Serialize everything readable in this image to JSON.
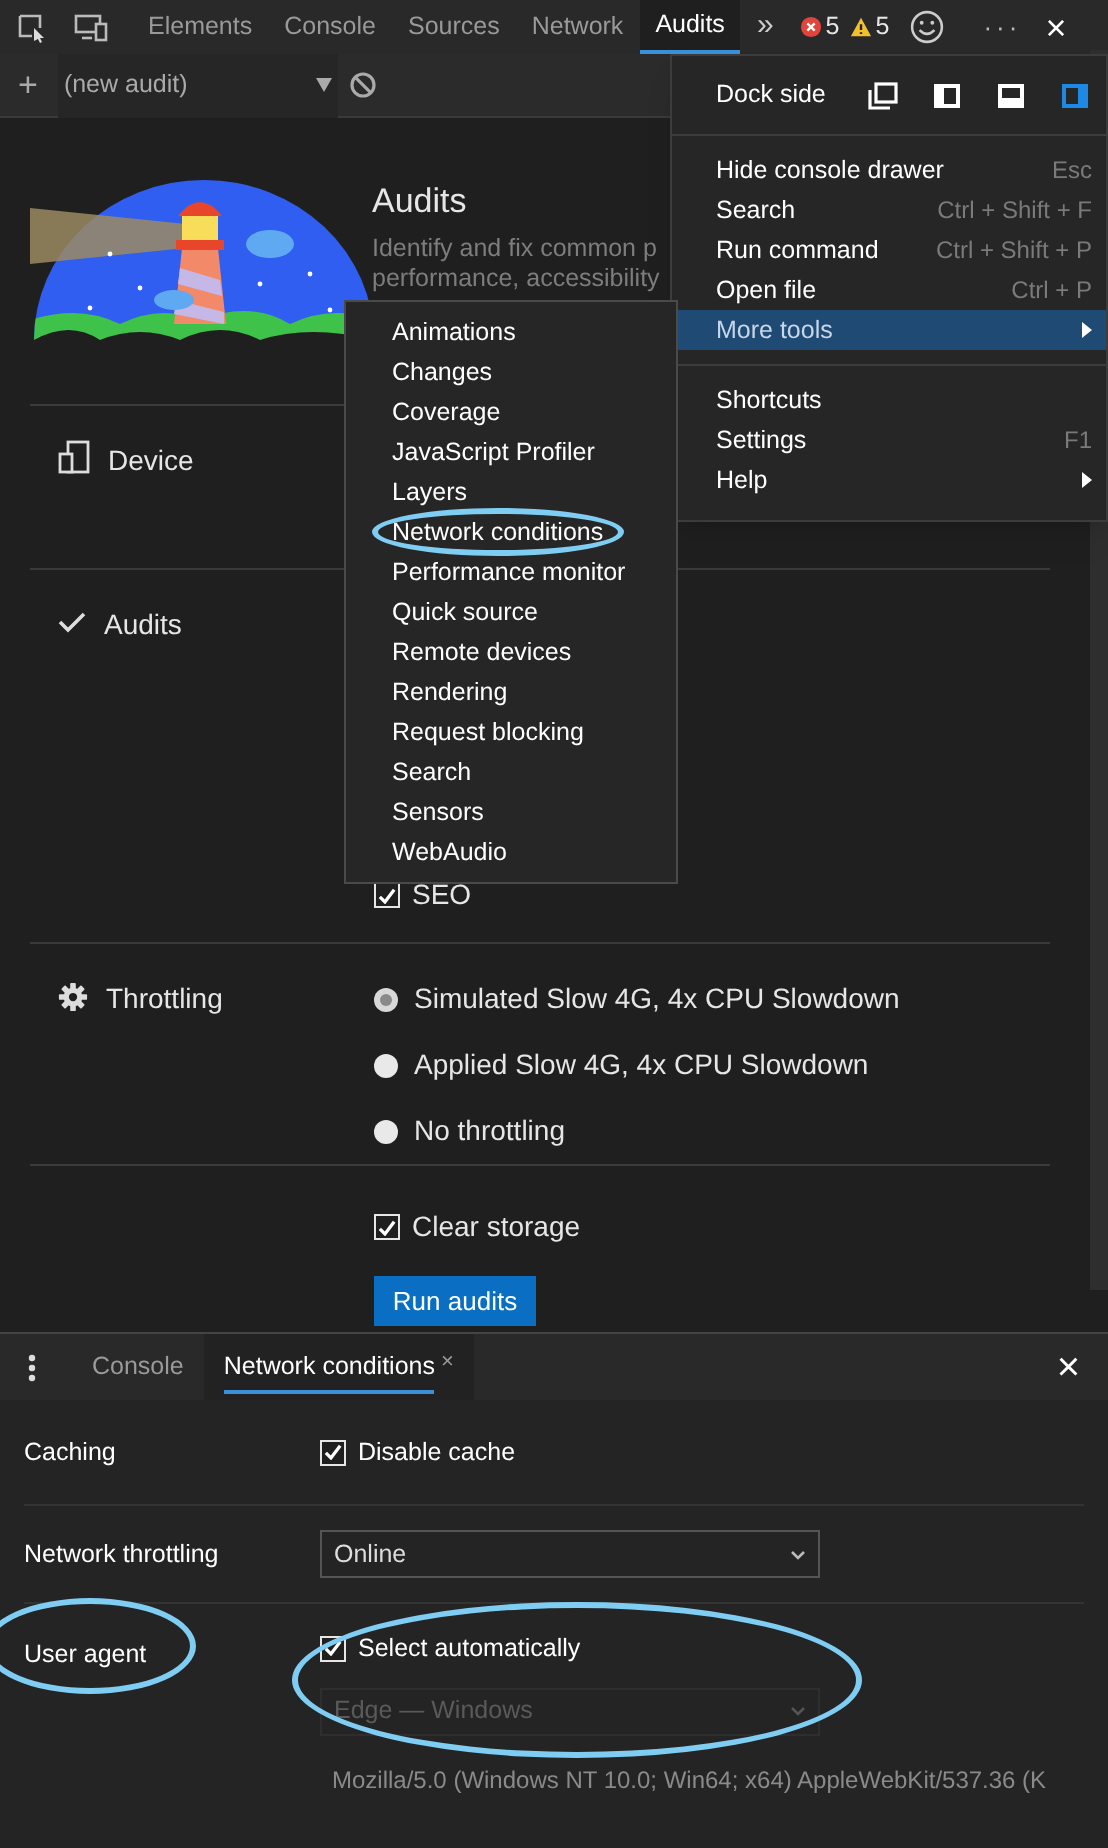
{
  "top_tabs": [
    {
      "label": "Elements",
      "selected": false
    },
    {
      "label": "Console",
      "selected": false
    },
    {
      "label": "Sources",
      "selected": false
    },
    {
      "label": "Network",
      "selected": false
    },
    {
      "label": "Audits",
      "selected": true
    }
  ],
  "more_tabs": "»",
  "errors": "5",
  "warnings": "5",
  "overflow": "···",
  "close": "×",
  "toolbar": {
    "add": "+",
    "audit_select": "(new audit)"
  },
  "audits_panel": {
    "title": "Audits",
    "description": [
      "Identify and fix common p",
      "performance, accessibility"
    ],
    "sections": [
      {
        "kind": "device",
        "label": "Device"
      },
      {
        "kind": "audits",
        "label": "Audits",
        "categories": [
          {
            "label": "SEO",
            "checked": true
          }
        ]
      },
      {
        "kind": "throttling",
        "label": "Throttling",
        "options": [
          {
            "label": "Simulated Slow 4G, 4x CPU Slowdown",
            "selected": true
          },
          {
            "label": "Applied Slow 4G, 4x CPU Slowdown",
            "selected": false
          },
          {
            "label": "No throttling",
            "selected": false
          }
        ]
      },
      {
        "kind": "storage",
        "options": [
          {
            "label": "Clear storage",
            "checked": true
          }
        ],
        "button": "Run audits"
      }
    ]
  },
  "main_menu": {
    "dock_side": {
      "label": "Dock side",
      "options": [
        {
          "selected": false
        },
        {
          "selected": false
        },
        {
          "selected": false
        },
        {
          "selected": true
        }
      ]
    },
    "groups": [
      [
        {
          "label": "Hide console drawer",
          "shortcut": "Esc",
          "submenu": false,
          "selected": false
        },
        {
          "label": "Search",
          "shortcut": "Ctrl + Shift + F",
          "submenu": false,
          "selected": false
        },
        {
          "label": "Run command",
          "shortcut": "Ctrl + Shift + P",
          "submenu": false,
          "selected": false
        },
        {
          "label": "Open file",
          "shortcut": "Ctrl + P",
          "submenu": false,
          "selected": false
        },
        {
          "label": "More tools",
          "submenu": true,
          "selected": true
        }
      ],
      [
        {
          "label": "Shortcuts",
          "submenu": false,
          "selected": false
        },
        {
          "label": "Settings",
          "shortcut": "F1",
          "submenu": false,
          "selected": false
        },
        {
          "label": "Help",
          "submenu": true,
          "selected": false
        }
      ]
    ]
  },
  "more_tools_menu": {
    "items": [
      {
        "label": "Animations",
        "circled": false
      },
      {
        "label": "Changes",
        "circled": false
      },
      {
        "label": "Coverage",
        "circled": false
      },
      {
        "label": "JavaScript Profiler",
        "circled": false
      },
      {
        "label": "Layers",
        "circled": false
      },
      {
        "label": "Network conditions",
        "circled": true
      },
      {
        "label": "Performance monitor",
        "circled": false
      },
      {
        "label": "Quick source",
        "circled": false
      },
      {
        "label": "Remote devices",
        "circled": false
      },
      {
        "label": "Rendering",
        "circled": false
      },
      {
        "label": "Request blocking",
        "circled": false
      },
      {
        "label": "Search",
        "circled": false
      },
      {
        "label": "Sensors",
        "circled": false
      },
      {
        "label": "WebAudio",
        "circled": false
      }
    ]
  },
  "drawer": {
    "tabs": [
      {
        "label": "Console",
        "selected": false,
        "closable": false
      },
      {
        "label": "Network conditions",
        "selected": true,
        "closable": true
      }
    ],
    "close": "×",
    "rows": [
      {
        "kind": "checkbox",
        "label": "Caching",
        "label_circled": false,
        "controls_circled": false,
        "checkbox": {
          "label": "Disable cache",
          "checked": true
        }
      },
      {
        "kind": "select",
        "label": "Network throttling",
        "label_circled": false,
        "controls_circled": false,
        "select": {
          "value": "Online",
          "disabled": false
        }
      },
      {
        "kind": "user_agent",
        "label": "User agent",
        "label_circled": true,
        "controls_circled": true,
        "checkbox": {
          "label": "Select automatically",
          "checked": true
        },
        "select": {
          "value": "Edge — Windows",
          "disabled": true
        },
        "ua_string": "Mozilla/5.0 (Windows NT 10.0; Win64; x64) AppleWebKit/537.36 (K"
      }
    ]
  }
}
